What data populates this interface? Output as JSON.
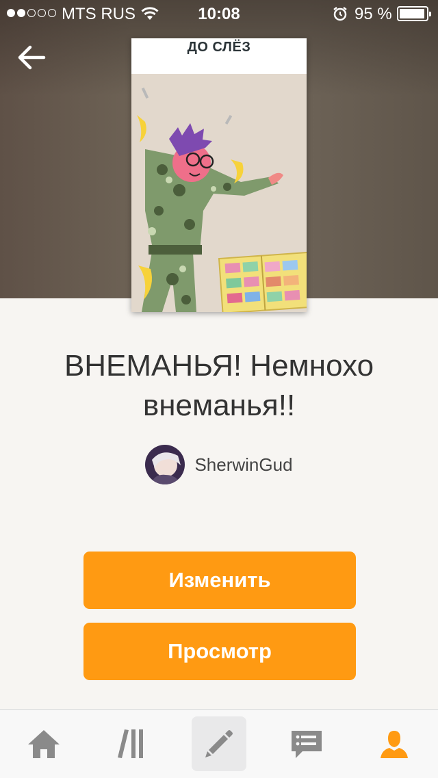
{
  "status_bar": {
    "signal_dots_filled": 2,
    "signal_dots_total": 5,
    "carrier": "MTS RUS",
    "time": "10:08",
    "battery_percent": "95 %"
  },
  "cover": {
    "caption": "ДО СЛЁЗ"
  },
  "story": {
    "title": "ВНЕМАНЬЯ! Немнохо внеманья!!",
    "author": "SherwinGud"
  },
  "buttons": {
    "edit": "Изменить",
    "preview": "Просмотр"
  },
  "tabbar": {
    "tabs": [
      {
        "icon": "home-icon"
      },
      {
        "icon": "library-icon"
      },
      {
        "icon": "pencil-icon",
        "highlighted": true
      },
      {
        "icon": "messages-icon"
      },
      {
        "icon": "profile-icon",
        "active": true
      }
    ]
  },
  "colors": {
    "accent": "#ff9a12",
    "tab_icon": "#8a8a8a",
    "tab_active": "#ff9a12",
    "text": "#333333"
  }
}
